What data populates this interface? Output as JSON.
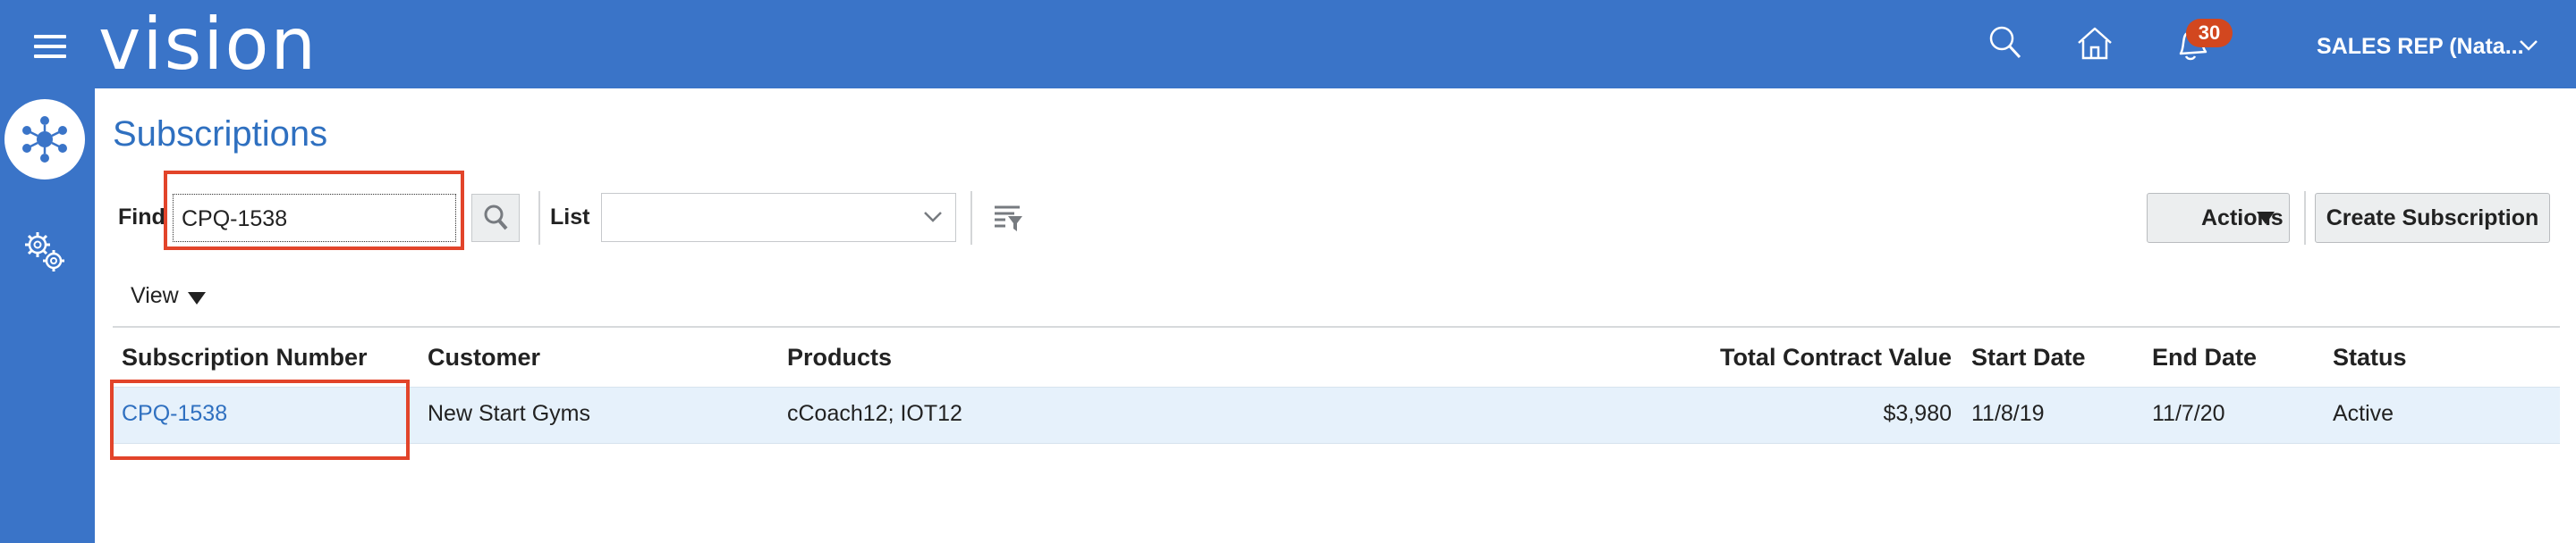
{
  "header": {
    "brand": "vision",
    "notifications_count": "30",
    "user": "SALES REP (Nata...",
    "colors": {
      "bar": "#3a74c8",
      "badge": "#d2471f",
      "highlight": "#e2442a",
      "link": "#2f70c0"
    },
    "icons": [
      "menu-icon",
      "search-icon",
      "home-icon",
      "bell-icon",
      "chevron-down-icon"
    ]
  },
  "sidebar": {
    "icons": [
      "workspace-network-icon",
      "gears-icon"
    ]
  },
  "page": {
    "title": "Subscriptions",
    "find_label": "Find",
    "find_value": "CPQ-1538",
    "list_label": "List",
    "list_value": "",
    "actions_label": "Actions",
    "create_label": "Create Subscription",
    "view_label": "View"
  },
  "table": {
    "columns": [
      "Subscription Number",
      "Customer",
      "Products",
      "Total Contract Value",
      "Start Date",
      "End Date",
      "Status"
    ],
    "rows": [
      {
        "number": "CPQ-1538",
        "customer": "New Start Gyms",
        "products": "cCoach12; IOT12",
        "value": "$3,980",
        "start": "11/8/19",
        "end": "11/7/20",
        "status": "Active"
      }
    ]
  }
}
